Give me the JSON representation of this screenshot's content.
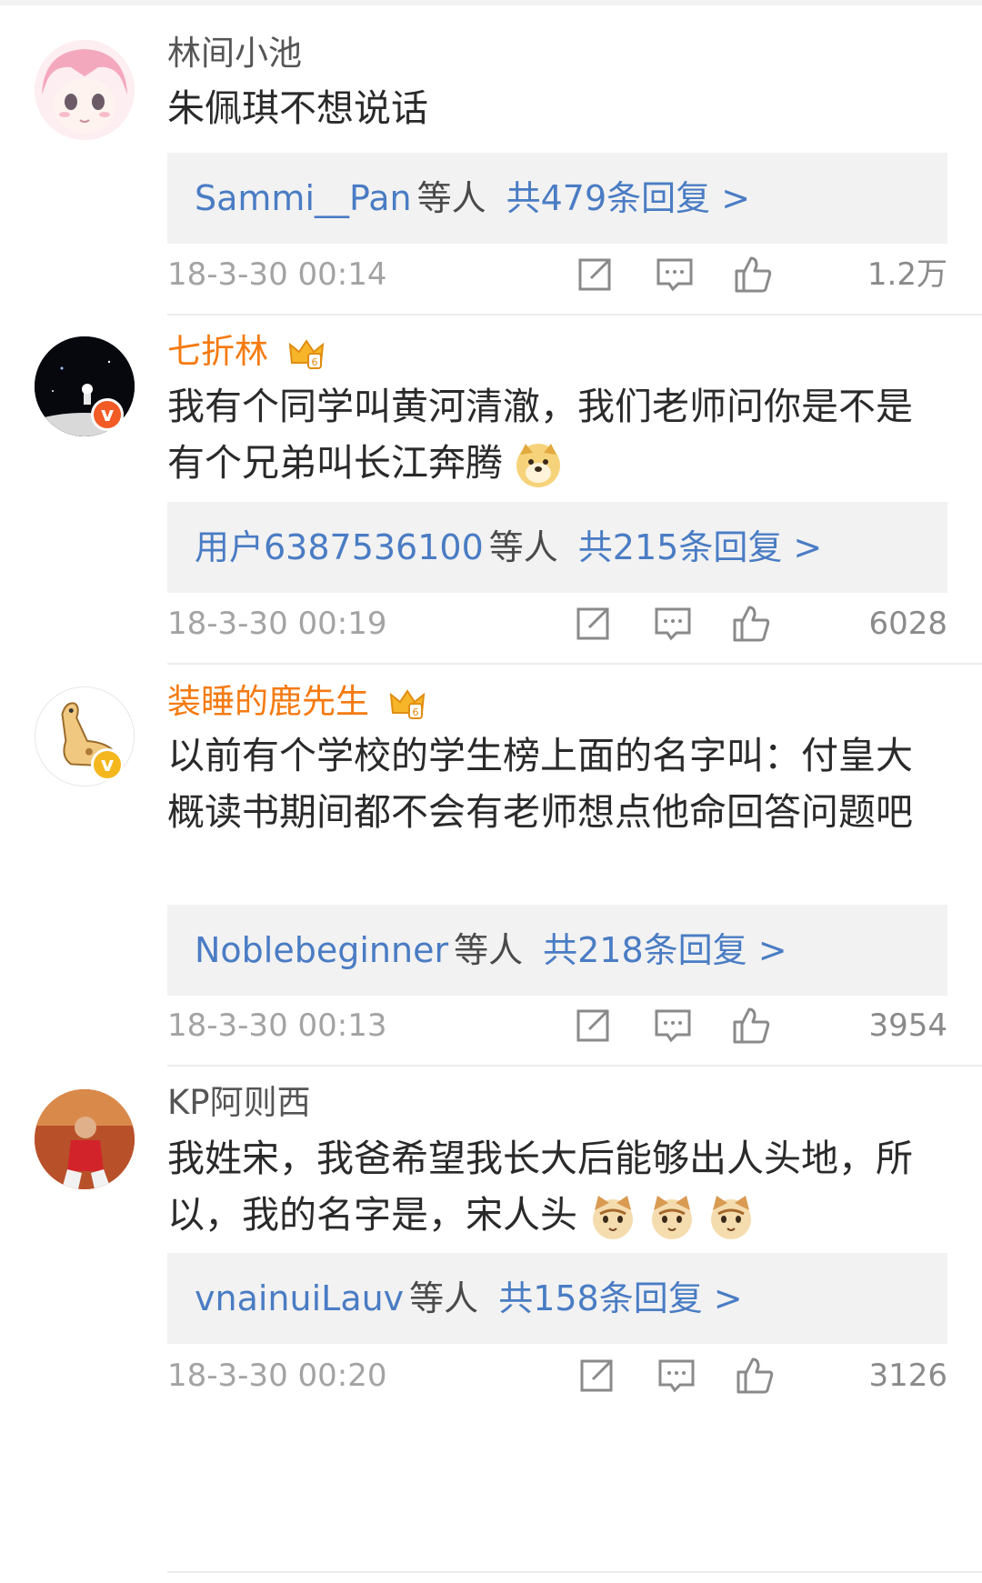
{
  "comments": [
    {
      "username": "林间小池",
      "text": "朱佩琪不想说话",
      "reply_users": "Sammi__Pan",
      "reply_etc": "等人",
      "reply_count": "共479条回复 >",
      "time": "18-3-30 00:14",
      "likes": "1.2万"
    },
    {
      "username": "七折林",
      "text": "我有个同学叫黄河清澈，我们老师问你是不是有个兄弟叫长江奔腾",
      "reply_users": "用户6387536100",
      "reply_etc": "等人",
      "reply_count": "共215条回复 >",
      "time": "18-3-30 00:19",
      "likes": "6028"
    },
    {
      "username": "装睡的鹿先生",
      "text": "以前有个学校的学生榜上面的名字叫：付皇大概读书期间都不会有老师想点他命回答问题吧",
      "reply_users": "Noblebeginner",
      "reply_etc": "等人",
      "reply_count": "共218条回复 >",
      "time": "18-3-30 00:13",
      "likes": "3954"
    },
    {
      "username": "KP阿则西",
      "text": "我姓宋，我爸希望我长大后能够出人头地，所以，我的名字是，宋人头",
      "reply_users": "vnainuiLauv",
      "reply_etc": "等人",
      "reply_count": "共158条回复 >",
      "time": "18-3-30 00:20",
      "likes": "3126"
    }
  ],
  "colors": {
    "link_blue": "#4a7cc4",
    "vip_orange": "#f57a10",
    "reply_bg": "#f2f2f2",
    "muted_gray": "#a3a3a3"
  },
  "icons": [
    "repost-icon",
    "comment-icon",
    "like-icon",
    "crown-icon",
    "doge-emoji",
    "cat-emoji"
  ]
}
